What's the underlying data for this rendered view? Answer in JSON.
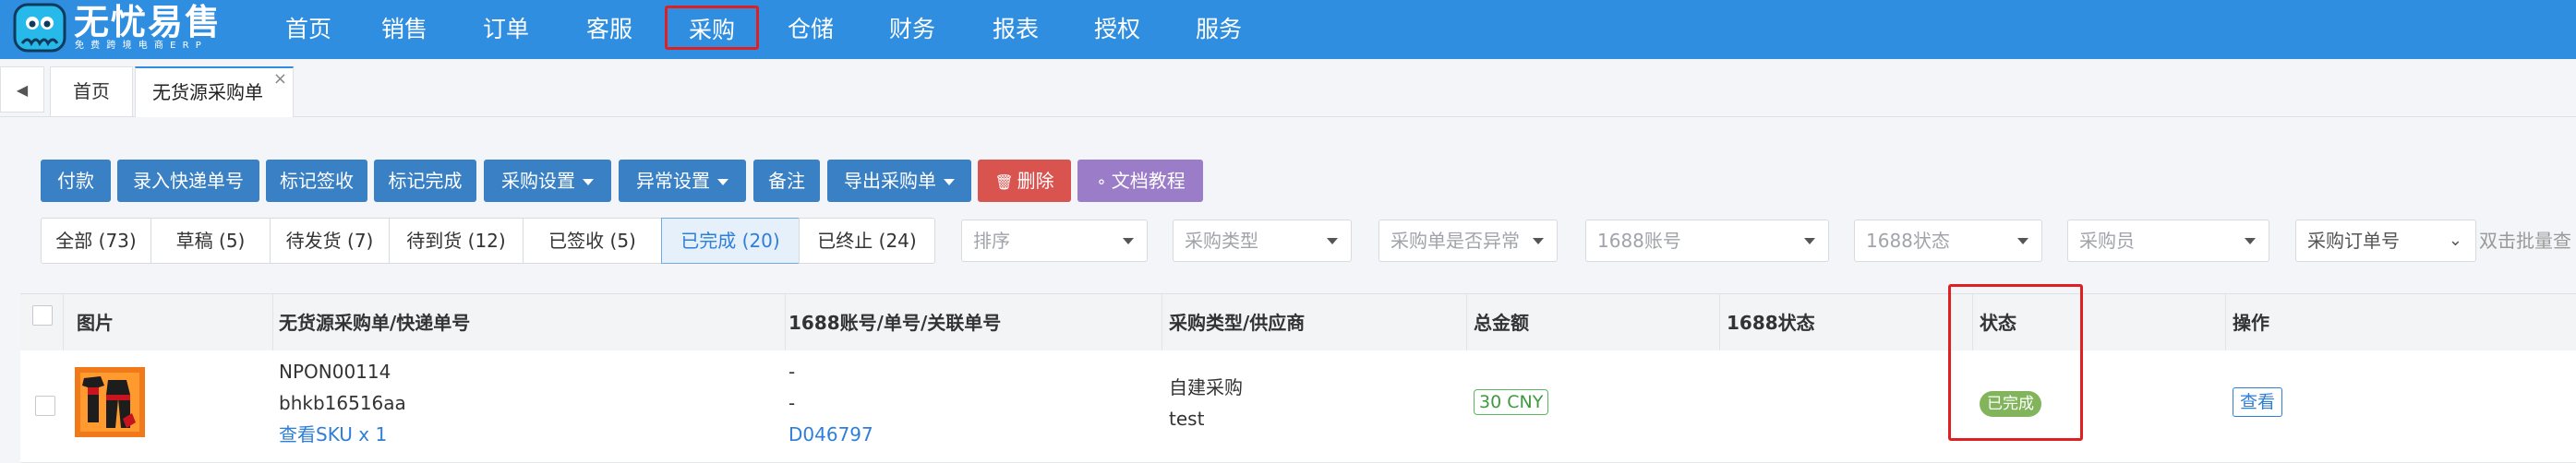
{
  "app": {
    "title": "无忧易售",
    "subtitle": "免 费 跨 境 电 商 E R P"
  },
  "nav": {
    "items": [
      "首页",
      "销售",
      "订单",
      "客服",
      "采购",
      "仓储",
      "财务",
      "报表",
      "授权",
      "服务"
    ],
    "highlighted": "采购"
  },
  "tabs": {
    "items": [
      "首页",
      "无货源采购单"
    ],
    "active": "无货源采购单",
    "close_glyph": "×"
  },
  "toolbar": {
    "buttons": [
      {
        "label": "付款"
      },
      {
        "label": "录入快递单号"
      },
      {
        "label": "标记签收"
      },
      {
        "label": "标记完成"
      },
      {
        "label": "采购设置",
        "dropdown": true
      },
      {
        "label": "异常设置",
        "dropdown": true
      },
      {
        "label": "备注"
      },
      {
        "label": "导出采购单",
        "dropdown": true
      },
      {
        "label": "删除",
        "icon": "trash-icon",
        "style": "danger"
      },
      {
        "label": "文档教程",
        "icon": "lightbulb-icon",
        "style": "purple"
      }
    ]
  },
  "filters": {
    "status_segments": [
      "全部 (73)",
      "草稿 (5)",
      "待发货 (7)",
      "待到货 (12)",
      "已签收 (5)",
      "已完成 (20)",
      "已终止 (24)"
    ],
    "active_segment": "已完成 (20)",
    "selects": [
      {
        "placeholder": "排序"
      },
      {
        "placeholder": "采购类型"
      },
      {
        "placeholder": "采购单是否异常"
      },
      {
        "placeholder": "1688账号"
      },
      {
        "placeholder": "1688状态"
      },
      {
        "placeholder": "采购员"
      },
      {
        "placeholder": "采购订单号"
      }
    ],
    "bulk_search_hint": "双击批量查"
  },
  "table": {
    "columns": [
      "图片",
      "无货源采购单/快递单号",
      "1688账号/单号/关联单号",
      "采购类型/供应商",
      "总金额",
      "1688状态",
      "状态",
      "操作"
    ],
    "rows": [
      {
        "image": "product-thumbnail",
        "order_no": "NPON00114",
        "tracking_no": "bhkb16516aa",
        "sku_link": "查看SKU x 1",
        "account": "-",
        "order_1688": "-",
        "related_no": "D046797",
        "purchase_type": "自建采购",
        "supplier": "test",
        "total": "30 CNY",
        "status_1688": "",
        "status": "已完成",
        "action": "查看"
      }
    ]
  },
  "colors": {
    "topbar": "#2f8ee0",
    "primary_button": "#3a80c5",
    "danger_button": "#d9534f",
    "purple_button": "#9b7cc8",
    "highlight_box": "#e02020",
    "status_done": "#82b45c"
  }
}
